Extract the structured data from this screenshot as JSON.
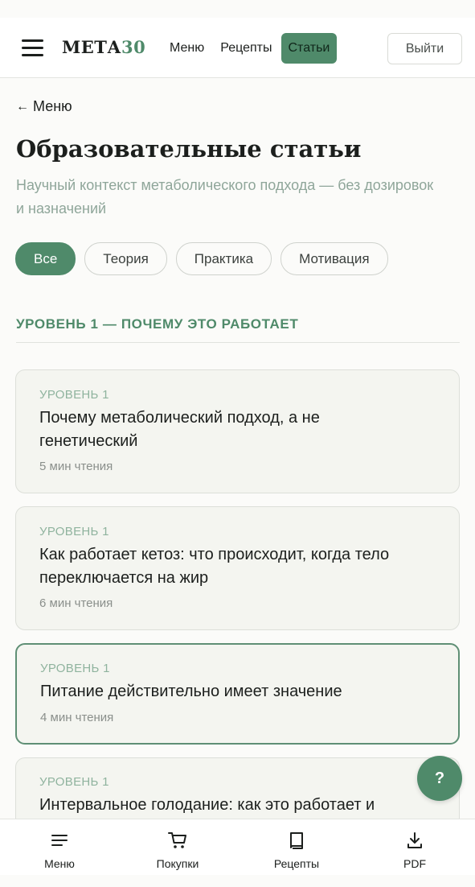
{
  "header": {
    "logo_main": "МЕТА",
    "logo_accent": "30",
    "nav": [
      {
        "label": "Меню",
        "active": false
      },
      {
        "label": "Рецепты",
        "active": false
      },
      {
        "label": "Статьи",
        "active": true
      }
    ],
    "logout_label": "Выйти",
    "menu_icon": "hamburger-icon",
    "accent_color": "#4f8a6a"
  },
  "back_link": {
    "arrow": "←",
    "label": "Меню"
  },
  "page": {
    "title": "Образовательные статьи",
    "subtitle": "Научный контекст метаболического подхода — без дозировок и назначений"
  },
  "filters": [
    {
      "label": "Все",
      "active": true
    },
    {
      "label": "Теория",
      "active": false
    },
    {
      "label": "Практика",
      "active": false
    },
    {
      "label": "Мотивация",
      "active": false
    }
  ],
  "section": {
    "heading": "УРОВЕНЬ 1 — ПОЧЕМУ ЭТО РАБОТАЕТ"
  },
  "articles": [
    {
      "level": "УРОВЕНЬ 1",
      "title": "Почему метаболический подход, а не генетический",
      "read_time": "5 мин чтения"
    },
    {
      "level": "УРОВЕНЬ 1",
      "title": "Как работает кетоз: что происходит, когда тело переключается на жир",
      "read_time": "6 мин чтения"
    },
    {
      "level": "УРОВЕНЬ 1",
      "title": "Питание действительно имеет значение",
      "read_time": "4 мин чтения"
    },
    {
      "level": "УРОВЕНЬ 1",
      "title": "Интервальное голодание: как это работает и"
    }
  ],
  "help_button": {
    "label": "?"
  },
  "bottom_nav": [
    {
      "label": "Меню",
      "icon": "menu-lines-icon"
    },
    {
      "label": "Покупки",
      "icon": "cart-icon"
    },
    {
      "label": "Рецепты",
      "icon": "book-icon"
    },
    {
      "label": "PDF",
      "icon": "download-icon"
    }
  ]
}
